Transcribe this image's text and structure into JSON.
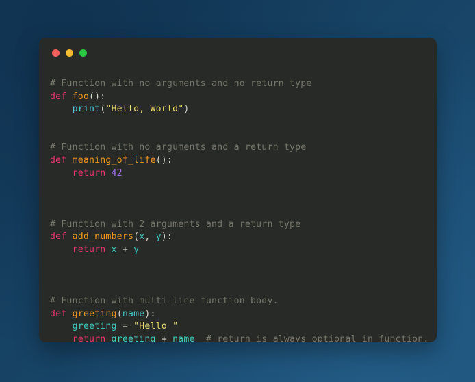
{
  "window": {
    "dots": [
      {
        "name": "close",
        "color": "#f4615c"
      },
      {
        "name": "minimize",
        "color": "#f6bd31"
      },
      {
        "name": "maximize",
        "color": "#2ac840"
      }
    ]
  },
  "theme": {
    "page_background": "#16405f",
    "card_background": "#282a27",
    "comment": "#75756a",
    "keyword": "#e8336e",
    "function": "#ef9520",
    "builtin": "#4fc9d8",
    "string": "#e6d76a",
    "number": "#a371e6",
    "variable": "#3fc9c0",
    "punctuation": "#d6d6cc"
  },
  "code": {
    "language": "python",
    "lines": [
      {
        "tokens": [
          {
            "t": "# Function with no arguments and no return type",
            "c": "comment"
          }
        ]
      },
      {
        "tokens": [
          {
            "t": "def",
            "c": "keyword"
          },
          {
            "t": " ",
            "c": "punct"
          },
          {
            "t": "foo",
            "c": "func"
          },
          {
            "t": "():",
            "c": "punct"
          }
        ]
      },
      {
        "tokens": [
          {
            "t": "    ",
            "c": "punct"
          },
          {
            "t": "print",
            "c": "builtin"
          },
          {
            "t": "(",
            "c": "punct"
          },
          {
            "t": "\"Hello, World\"",
            "c": "string"
          },
          {
            "t": ")",
            "c": "punct"
          }
        ]
      },
      {
        "blank": true
      },
      {
        "blank": true
      },
      {
        "tokens": [
          {
            "t": "# Function with no arguments and a return type",
            "c": "comment"
          }
        ]
      },
      {
        "tokens": [
          {
            "t": "def",
            "c": "keyword"
          },
          {
            "t": " ",
            "c": "punct"
          },
          {
            "t": "meaning_of_life",
            "c": "func"
          },
          {
            "t": "():",
            "c": "punct"
          }
        ]
      },
      {
        "tokens": [
          {
            "t": "    ",
            "c": "punct"
          },
          {
            "t": "return",
            "c": "keyword"
          },
          {
            "t": " ",
            "c": "punct"
          },
          {
            "t": "42",
            "c": "number"
          }
        ]
      },
      {
        "blank": true
      },
      {
        "blank": true
      },
      {
        "blank": true
      },
      {
        "tokens": [
          {
            "t": "# Function with 2 arguments and a return type",
            "c": "comment"
          }
        ]
      },
      {
        "tokens": [
          {
            "t": "def",
            "c": "keyword"
          },
          {
            "t": " ",
            "c": "punct"
          },
          {
            "t": "add_numbers",
            "c": "func"
          },
          {
            "t": "(",
            "c": "punct"
          },
          {
            "t": "x",
            "c": "var"
          },
          {
            "t": ", ",
            "c": "punct"
          },
          {
            "t": "y",
            "c": "var"
          },
          {
            "t": "):",
            "c": "punct"
          }
        ]
      },
      {
        "tokens": [
          {
            "t": "    ",
            "c": "punct"
          },
          {
            "t": "return",
            "c": "keyword"
          },
          {
            "t": " ",
            "c": "punct"
          },
          {
            "t": "x",
            "c": "var"
          },
          {
            "t": " + ",
            "c": "op"
          },
          {
            "t": "y",
            "c": "var"
          }
        ]
      },
      {
        "blank": true
      },
      {
        "blank": true
      },
      {
        "blank": true
      },
      {
        "tokens": [
          {
            "t": "# Function with multi-line function body.",
            "c": "comment"
          }
        ]
      },
      {
        "tokens": [
          {
            "t": "def",
            "c": "keyword"
          },
          {
            "t": " ",
            "c": "punct"
          },
          {
            "t": "greeting",
            "c": "func"
          },
          {
            "t": "(",
            "c": "punct"
          },
          {
            "t": "name",
            "c": "var"
          },
          {
            "t": "):",
            "c": "punct"
          }
        ]
      },
      {
        "tokens": [
          {
            "t": "    ",
            "c": "punct"
          },
          {
            "t": "greeting",
            "c": "var"
          },
          {
            "t": " = ",
            "c": "op"
          },
          {
            "t": "\"Hello \"",
            "c": "string"
          }
        ]
      },
      {
        "tokens": [
          {
            "t": "    ",
            "c": "punct"
          },
          {
            "t": "return",
            "c": "keyword"
          },
          {
            "t": " ",
            "c": "punct"
          },
          {
            "t": "greeting",
            "c": "var"
          },
          {
            "t": " + ",
            "c": "op"
          },
          {
            "t": "name",
            "c": "var"
          },
          {
            "t": "  ",
            "c": "punct"
          },
          {
            "t": "# return is always optional in function.",
            "c": "comment"
          }
        ]
      }
    ]
  }
}
